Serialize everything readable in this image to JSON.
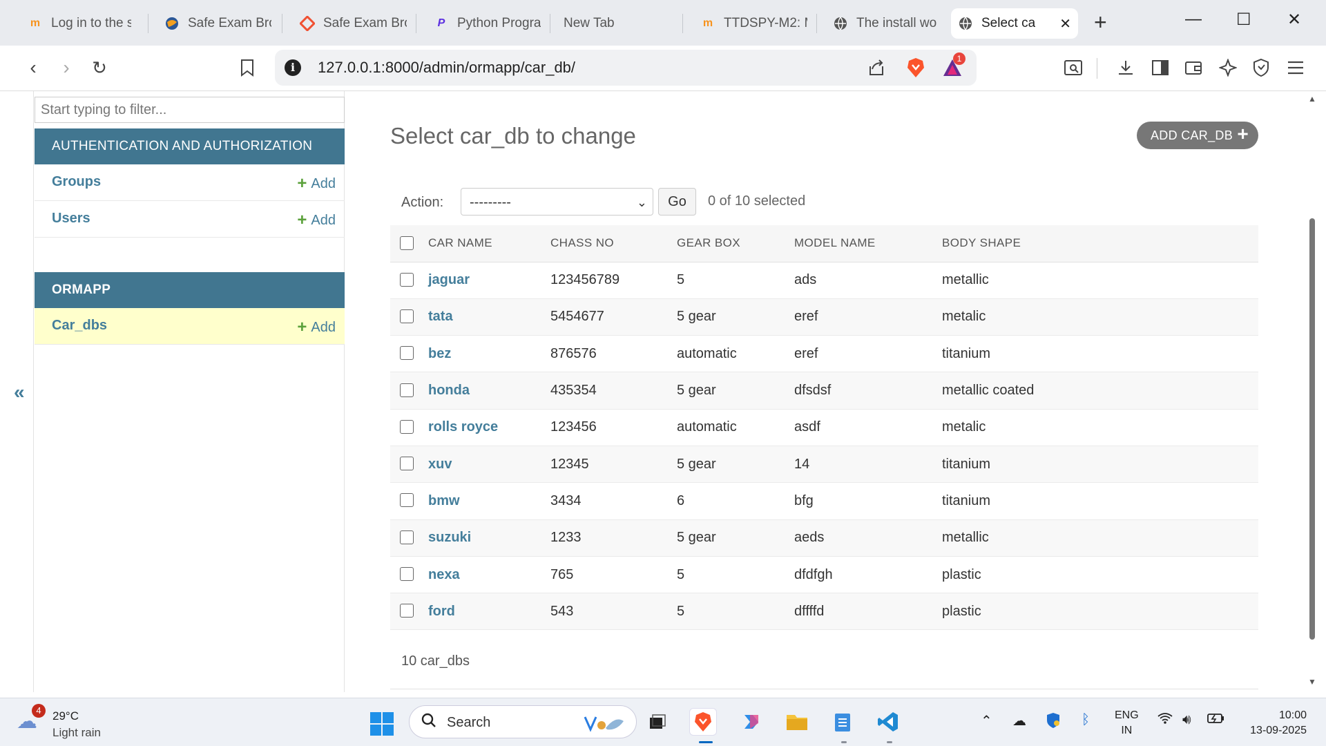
{
  "browser": {
    "tabs": [
      {
        "title": "Log in to the s",
        "icon": "moodle-icon"
      },
      {
        "title": "Safe Exam Bro",
        "icon": "seb-globe-icon"
      },
      {
        "title": "Safe Exam Bro",
        "icon": "git-diamond-icon"
      },
      {
        "title": "Python Progra",
        "icon": "purple-p-icon"
      },
      {
        "title": "New Tab",
        "icon": ""
      },
      {
        "title": "TTDSPY-M2: M",
        "icon": "moodle-icon"
      },
      {
        "title": "The install wo",
        "icon": "globe-icon"
      },
      {
        "title": "Select ca",
        "icon": "globe-icon",
        "active": true
      }
    ],
    "url": "127.0.0.1:8000/admin/ormapp/car_db/",
    "brave_rewards_count": "1"
  },
  "sidebar": {
    "filter_placeholder": "Start typing to filter...",
    "modules": [
      {
        "header": "AUTHENTICATION AND AUTHORIZATION",
        "models": [
          {
            "name": "Groups",
            "add": "Add"
          },
          {
            "name": "Users",
            "add": "Add"
          }
        ]
      },
      {
        "header": "ORMAPP",
        "models": [
          {
            "name": "Car_dbs",
            "add": "Add",
            "selected": true
          }
        ]
      }
    ],
    "collapse_glyph": "«"
  },
  "main": {
    "title": "Select car_db to change",
    "add_button": "ADD CAR_DB",
    "action_label": "Action:",
    "action_selected": "---------",
    "go_label": "Go",
    "selection_count": "0 of 10 selected",
    "columns": [
      "CAR NAME",
      "CHASS NO",
      "GEAR BOX",
      "MODEL NAME",
      "BODY SHAPE"
    ],
    "rows": [
      [
        "jaguar",
        "123456789",
        "5",
        "ads",
        "metallic"
      ],
      [
        "tata",
        "5454677",
        "5 gear",
        "eref",
        "metalic"
      ],
      [
        "bez",
        "876576",
        "automatic",
        "eref",
        "titanium"
      ],
      [
        "honda",
        "435354",
        "5 gear",
        "dfsdsf",
        "metallic coated"
      ],
      [
        "rolls royce",
        "123456",
        "automatic",
        "asdf",
        "metalic"
      ],
      [
        "xuv",
        "12345",
        "5 gear",
        "14",
        "titanium"
      ],
      [
        "bmw",
        "3434",
        "6",
        "bfg",
        "titanium"
      ],
      [
        "suzuki",
        "1233",
        "5 gear",
        "aeds",
        "metallic"
      ],
      [
        "nexa",
        "765",
        "5",
        "dfdfgh",
        "plastic"
      ],
      [
        "ford",
        "543",
        "5",
        "dffffd",
        "plastic"
      ]
    ],
    "result_count": "10 car_dbs"
  },
  "taskbar": {
    "weather": {
      "temp": "29°C",
      "desc": "Light rain",
      "badge": "4"
    },
    "search_label": "Search",
    "lang_line1": "ENG",
    "lang_line2": "IN",
    "time": "10:00",
    "date": "13-09-2025"
  },
  "colors": {
    "module_header": "#417690",
    "link": "#447e9b",
    "add_plus": "#5ba13b",
    "selected_row": "#ffffcc",
    "add_button_bg": "#777777"
  }
}
